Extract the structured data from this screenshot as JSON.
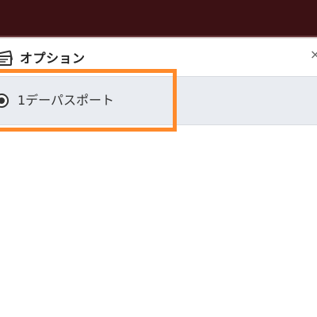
{
  "panel": {
    "title": "オプション",
    "header_icon": "ticket-icon",
    "close_glyph": "×",
    "close_icon": "close-icon"
  },
  "options": [
    {
      "label": "1デーパスポート",
      "selected": true
    }
  ],
  "colors": {
    "top_bar": "#3c1114",
    "option_bg": "#e9ecf1",
    "highlight": "#ff8a2b"
  }
}
